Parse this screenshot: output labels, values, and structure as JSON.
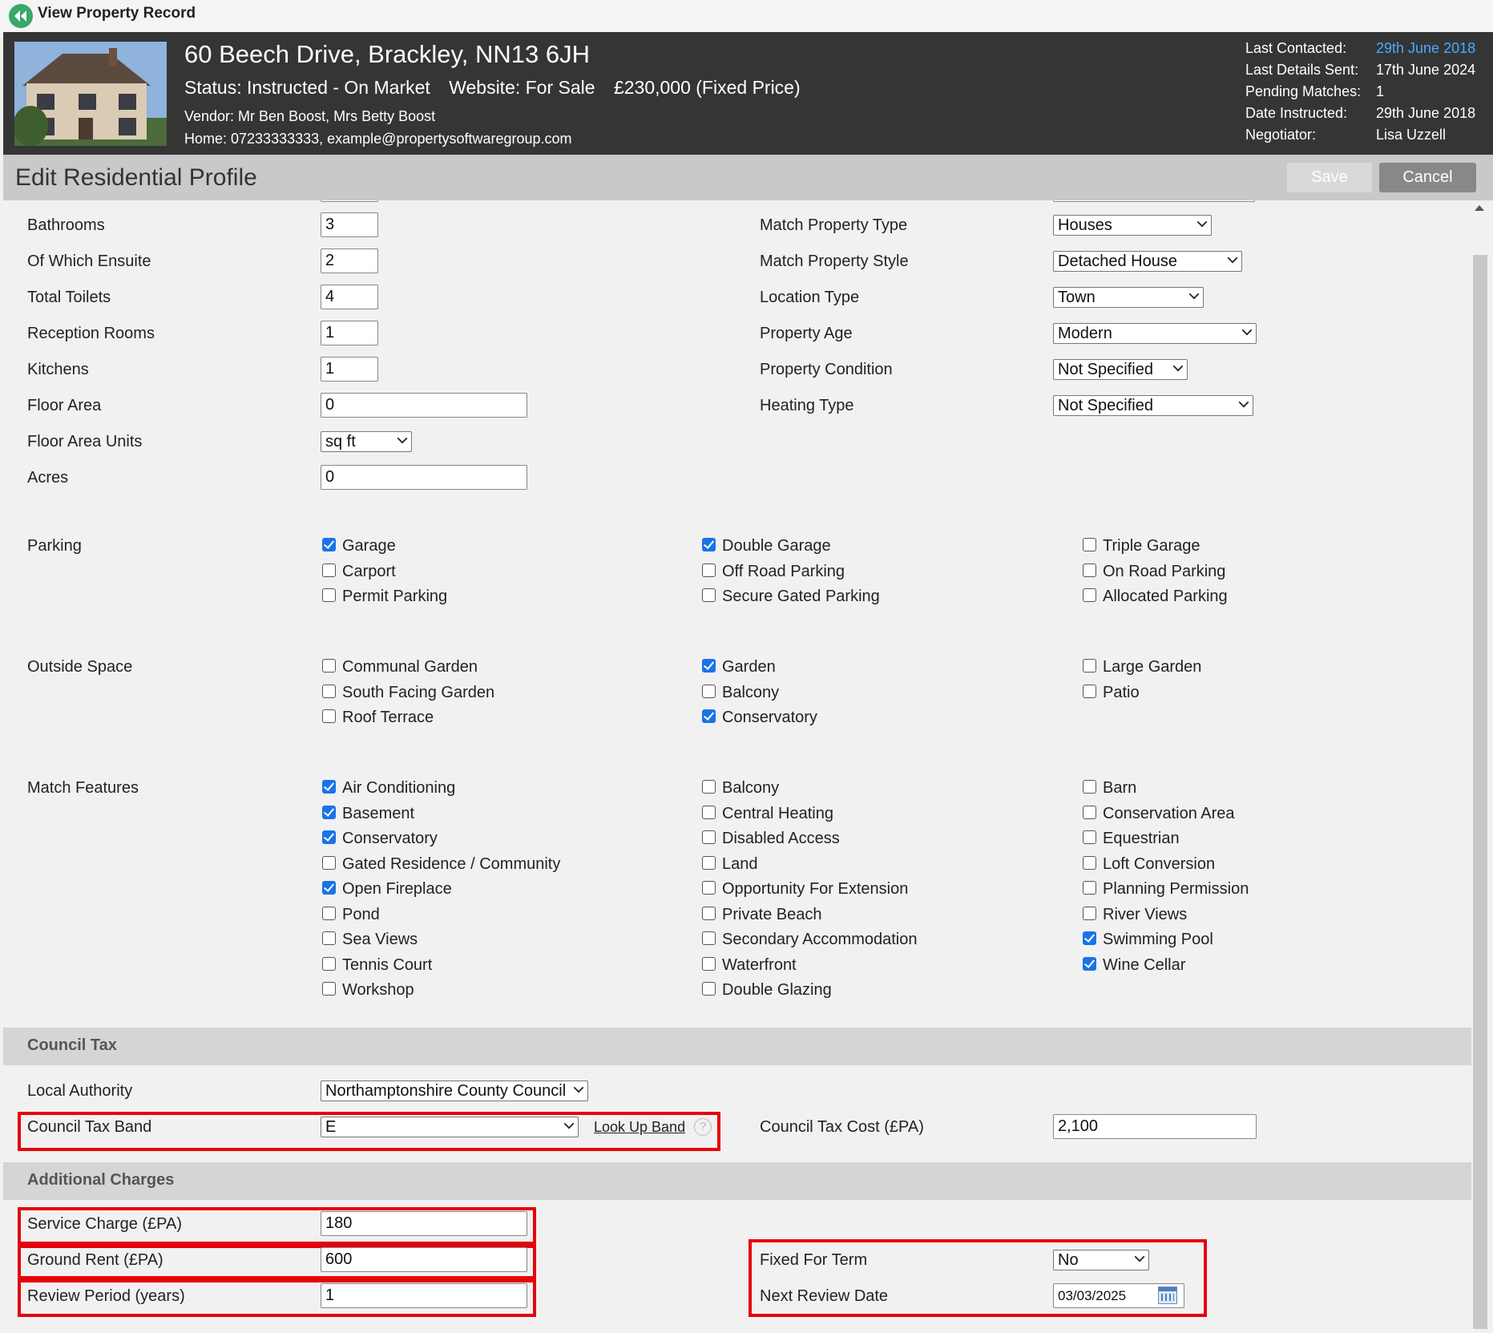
{
  "topbar": {
    "title": "View Property Record"
  },
  "header": {
    "address": "60 Beech Drive, Brackley, NN13 6JH",
    "status": "Status: Instructed - On Market",
    "website": "Website: For Sale",
    "price": "£230,000 (Fixed Price)",
    "vendor": "Vendor: Mr Ben Boost, Mrs Betty Boost",
    "home": "Home: 07233333333, example@propertysoftwaregroup.com",
    "meta": [
      {
        "key": "Last Contacted:",
        "value": "29th June 2018"
      },
      {
        "key": "Last Details Sent:",
        "value": "17th June 2024"
      },
      {
        "key": "Pending Matches:",
        "value": "1"
      },
      {
        "key": "Date Instructed:",
        "value": "29th June 2018"
      },
      {
        "key": "Negotiator:",
        "value": "Lisa Uzzell"
      }
    ],
    "link_color": "#49aaff"
  },
  "titlebar": {
    "title": "Edit Residential Profile",
    "save": "Save",
    "cancel": "Cancel"
  },
  "rooms": [
    {
      "label": "Bathrooms",
      "value": "3"
    },
    {
      "label": "Of Which Ensuite",
      "value": "2"
    },
    {
      "label": "Total Toilets",
      "value": "4"
    },
    {
      "label": "Reception Rooms",
      "value": "1"
    },
    {
      "label": "Kitchens",
      "value": "1"
    },
    {
      "label": "Floor Area",
      "value": "0"
    },
    {
      "label": "Floor Area Units",
      "value": "sq ft"
    },
    {
      "label": "Acres",
      "value": "0"
    }
  ],
  "matches": [
    {
      "label": "Match Property Type",
      "value": "Houses"
    },
    {
      "label": "Match Property Style",
      "value": "Detached House"
    },
    {
      "label": "Location Type",
      "value": "Town"
    },
    {
      "label": "Property Age",
      "value": "Modern"
    },
    {
      "label": "Property Condition",
      "value": "Not Specified"
    },
    {
      "label": "Heating Type",
      "value": "Not Specified"
    }
  ],
  "parking": {
    "label": "Parking",
    "items": [
      {
        "label": "Garage",
        "checked": true
      },
      {
        "label": "Double Garage",
        "checked": true
      },
      {
        "label": "Triple Garage",
        "checked": false
      },
      {
        "label": "Carport",
        "checked": false
      },
      {
        "label": "Off Road Parking",
        "checked": false
      },
      {
        "label": "On Road Parking",
        "checked": false
      },
      {
        "label": "Permit Parking",
        "checked": false
      },
      {
        "label": "Secure Gated Parking",
        "checked": false
      },
      {
        "label": "Allocated Parking",
        "checked": false
      }
    ]
  },
  "outside": {
    "label": "Outside Space",
    "items": [
      {
        "label": "Communal Garden",
        "checked": false
      },
      {
        "label": "Garden",
        "checked": true
      },
      {
        "label": "Large Garden",
        "checked": false
      },
      {
        "label": "South Facing Garden",
        "checked": false
      },
      {
        "label": "Balcony",
        "checked": false
      },
      {
        "label": "Patio",
        "checked": false
      },
      {
        "label": "Roof Terrace",
        "checked": false
      },
      {
        "label": "Conservatory",
        "checked": true
      }
    ]
  },
  "features": {
    "label": "Match Features",
    "items": [
      {
        "label": "Air Conditioning",
        "checked": true
      },
      {
        "label": "Balcony",
        "checked": false
      },
      {
        "label": "Barn",
        "checked": false
      },
      {
        "label": "Basement",
        "checked": true
      },
      {
        "label": "Central Heating",
        "checked": false
      },
      {
        "label": "Conservation Area",
        "checked": false
      },
      {
        "label": "Conservatory",
        "checked": true
      },
      {
        "label": "Disabled Access",
        "checked": false
      },
      {
        "label": "Equestrian",
        "checked": false
      },
      {
        "label": "Gated Residence / Community",
        "checked": false
      },
      {
        "label": "Land",
        "checked": false
      },
      {
        "label": "Loft Conversion",
        "checked": false
      },
      {
        "label": "Open Fireplace",
        "checked": true
      },
      {
        "label": "Opportunity For Extension",
        "checked": false
      },
      {
        "label": "Planning Permission",
        "checked": false
      },
      {
        "label": "Pond",
        "checked": false
      },
      {
        "label": "Private Beach",
        "checked": false
      },
      {
        "label": "River Views",
        "checked": false
      },
      {
        "label": "Sea Views",
        "checked": false
      },
      {
        "label": "Secondary Accommodation",
        "checked": false
      },
      {
        "label": "Swimming Pool",
        "checked": true
      },
      {
        "label": "Tennis Court",
        "checked": false
      },
      {
        "label": "Waterfront",
        "checked": false
      },
      {
        "label": "Wine Cellar",
        "checked": true
      },
      {
        "label": "Workshop",
        "checked": false
      },
      {
        "label": "Double Glazing",
        "checked": false
      }
    ]
  },
  "council": {
    "section": "Council Tax",
    "authority_label": "Local Authority",
    "authority_value": "Northamptonshire County Council",
    "band_label": "Council Tax Band",
    "band_value": "E",
    "lookup": "Look Up Band",
    "help": "?",
    "cost_label": "Council Tax Cost (£PA)",
    "cost_value": "2,100"
  },
  "charges": {
    "section": "Additional Charges",
    "service_label": "Service Charge (£PA)",
    "service_value": "180",
    "ground_label": "Ground Rent (£PA)",
    "ground_value": "600",
    "review_label": "Review Period (years)",
    "review_value": "1",
    "fixed_label": "Fixed For Term",
    "fixed_value": "No",
    "next_label": "Next Review Date",
    "next_value": "03/03/2025"
  },
  "highlight_color": "#e4040b",
  "checkbox_color": "#1a73e8"
}
